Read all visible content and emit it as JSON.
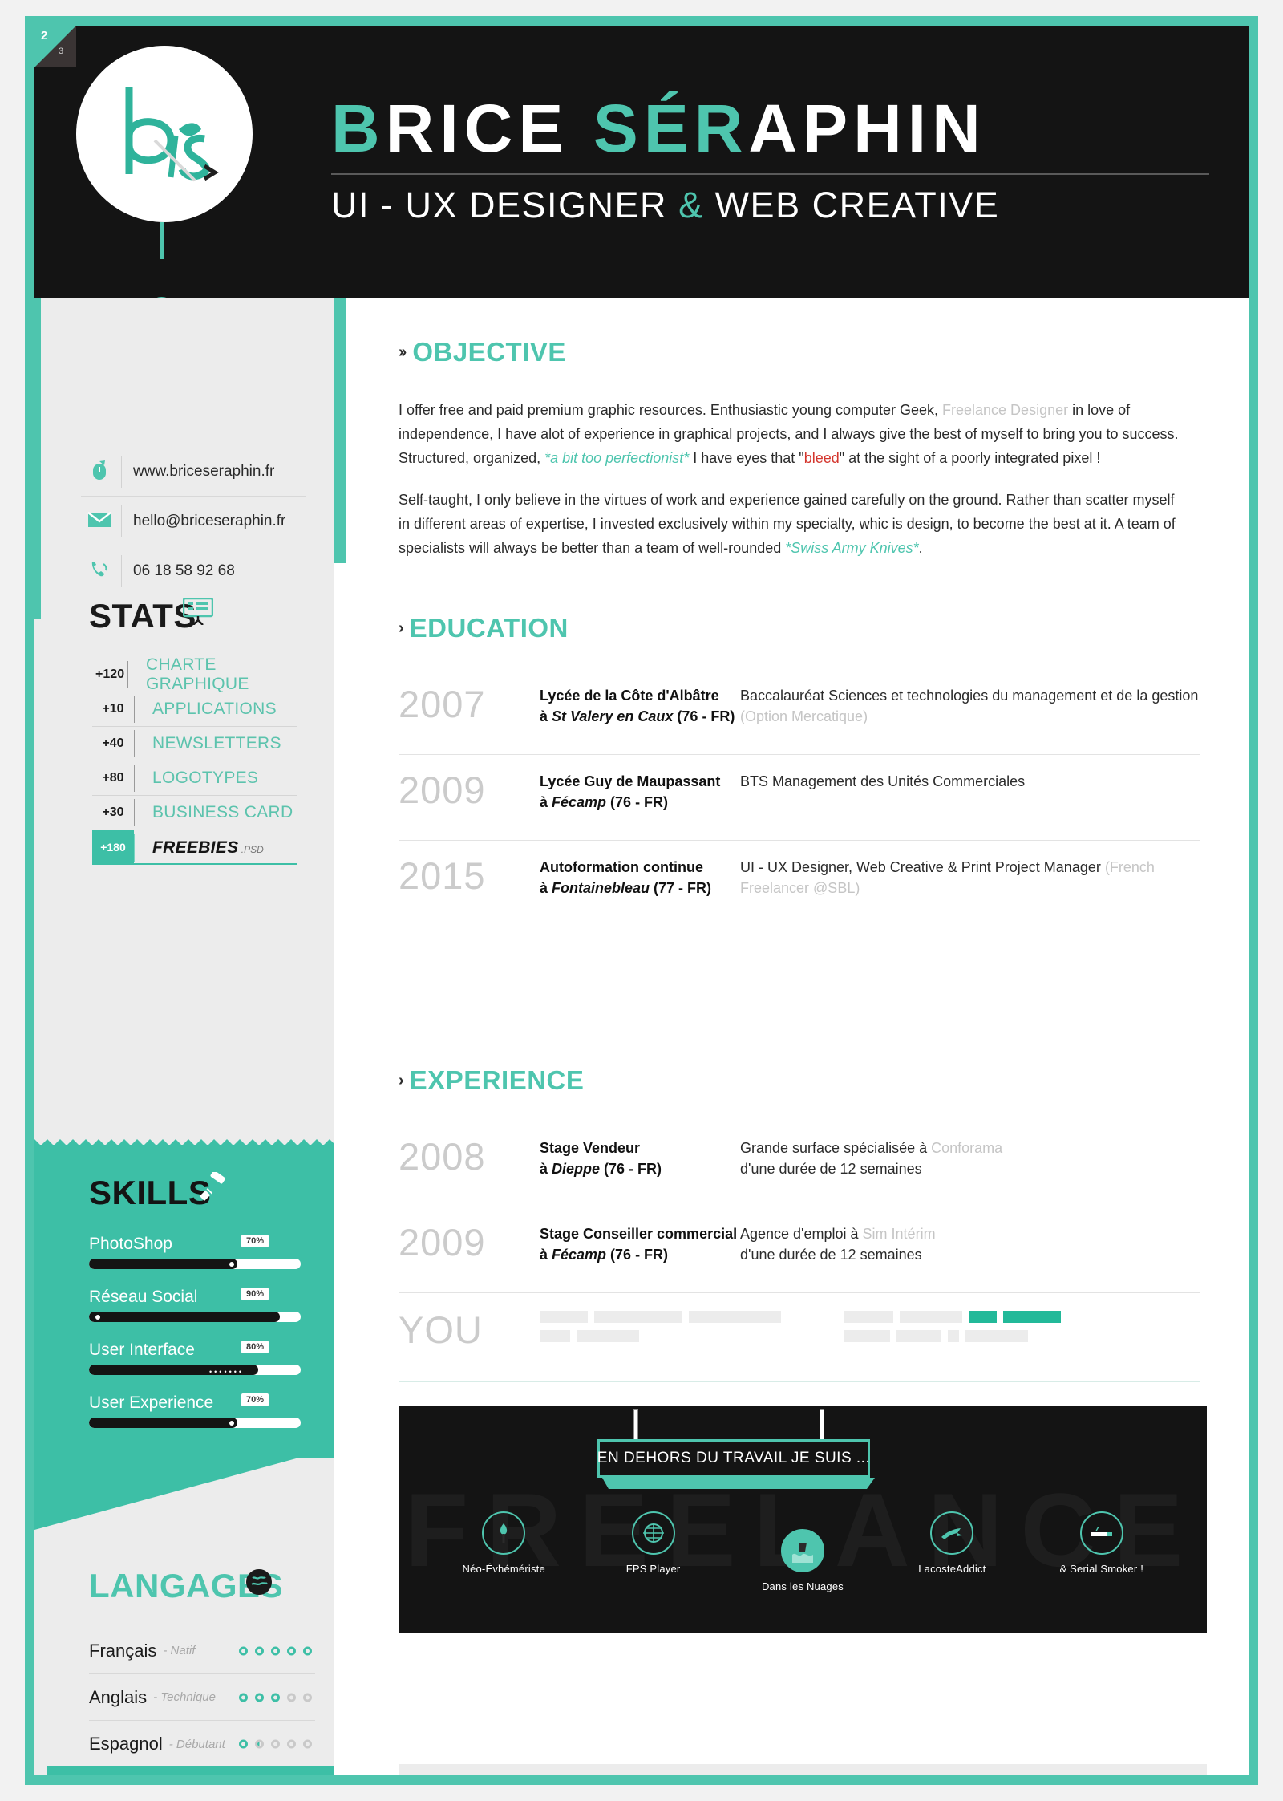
{
  "page_badge": {
    "current": "2",
    "total": "3"
  },
  "header": {
    "name_parts": [
      {
        "text": "B",
        "color": "teal"
      },
      {
        "text": "RICE ",
        "color": "white"
      },
      {
        "text": "SÉR",
        "color": "teal"
      },
      {
        "text": "APHIN",
        "color": "white"
      }
    ],
    "subtitle_before": "UI - UX DESIGNER ",
    "subtitle_amp": "&",
    "subtitle_after": " WEB CREATIVE",
    "logo_initials": "b s"
  },
  "contacts": [
    {
      "icon": "mouse-icon",
      "glyph": "❧",
      "text": "www.briceseraphin.fr"
    },
    {
      "icon": "envelope-icon",
      "glyph": "✉",
      "text": "hello@briceseraphin.fr"
    },
    {
      "icon": "phone-icon",
      "glyph": "☎",
      "text": "06 18 58 92 68"
    }
  ],
  "stats": {
    "title": "STATS",
    "icon": "presentation-chart-icon",
    "rows": [
      {
        "count": "+120",
        "label": "CHARTE GRAPHIQUE",
        "highlight": false,
        "suffix": ""
      },
      {
        "count": "+10",
        "label": "APPLICATIONS",
        "highlight": false,
        "suffix": ""
      },
      {
        "count": "+40",
        "label": "NEWSLETTERS",
        "highlight": false,
        "suffix": ""
      },
      {
        "count": "+80",
        "label": "LOGOTYPES",
        "highlight": false,
        "suffix": ""
      },
      {
        "count": "+30",
        "label": "BUSINESS CARD",
        "highlight": false,
        "suffix": ""
      },
      {
        "count": "+180",
        "label": "FREEBIES",
        "highlight": true,
        "suffix": ".PSD"
      }
    ]
  },
  "skills": {
    "title": "SKILLS",
    "icon": "paintbrush-icon",
    "items": [
      {
        "name": "PhotoShop",
        "percent": "70%",
        "value": 70,
        "style": "knob"
      },
      {
        "name": "Réseau Social",
        "percent": "90%",
        "value": 90,
        "style": "knob-left"
      },
      {
        "name": "User Interface",
        "percent": "80%",
        "value": 80,
        "style": "dots"
      },
      {
        "name": "User Experience",
        "percent": "70%",
        "value": 70,
        "style": "knob"
      }
    ]
  },
  "languages": {
    "title": "LANGAGES",
    "icon": "globe-icon",
    "items": [
      {
        "name": "Français",
        "level": "- Natif",
        "filled": 5,
        "half": 0,
        "total": 5
      },
      {
        "name": "Anglais",
        "level": "- Technique",
        "filled": 3,
        "half": 0,
        "total": 5
      },
      {
        "name": "Espagnol",
        "level": "- Débutant",
        "filled": 1,
        "half": 1,
        "total": 5
      }
    ]
  },
  "objective": {
    "chevron": "››",
    "title": "OBJECTIVE",
    "p1_a": "I offer free and paid premium graphic resources. Enthusiastic young computer Geek, ",
    "p1_grey": "Freelance Designer",
    "p1_b": " in love of independence, I have alot of experience in graphical projects, and I always give the best of myself to bring you to success. Structured, organized, ",
    "p1_teal": "*a bit too perfectionist*",
    "p1_c": " I have eyes that \"",
    "p1_red": "bleed",
    "p1_d": "\" at the sight of a poorly integrated pixel !",
    "p2_a": "Self-taught, I only believe in the virtues of work and experience gained carefully on the ground. Rather than scatter myself in different areas of expertise, I invested exclusively within my specialty, whic is design, to become the best at it. A team of specialists will always be better than a team of well-rounded ",
    "p2_teal": "*Swiss Army Knives*",
    "p2_b": "."
  },
  "education": {
    "chevron": "›",
    "title": "EDUCATION",
    "entries": [
      {
        "year": "2007",
        "school": "Lycée de la Côte d'Albâtre",
        "place_prefix": "à ",
        "place": "St Valery en Caux",
        "place_suffix": " (76 - FR)",
        "desc": "Baccalauréat Sciences et technologies du management et de la gestion ",
        "desc_grey": "(Option Mercatique)"
      },
      {
        "year": "2009",
        "school": "Lycée Guy de Maupassant",
        "place_prefix": "à ",
        "place": "Fécamp",
        "place_suffix": " (76 - FR)",
        "desc": "BTS Management des Unités Commerciales",
        "desc_grey": ""
      },
      {
        "year": "2015",
        "school": "Autoformation continue",
        "place_prefix": "à ",
        "place": "Fontainebleau",
        "place_suffix": " (77 - FR)",
        "desc": "UI - UX Designer, Web Creative & Print Project Manager ",
        "desc_grey": "(French Freelancer @SBL)"
      }
    ]
  },
  "experience": {
    "chevron": "›",
    "title": "EXPERIENCE",
    "entries": [
      {
        "year": "2008",
        "role": "Stage Vendeur",
        "place_prefix": "à ",
        "place": "Dieppe",
        "place_suffix": " (76 - FR)",
        "desc": "Grande surface spécialisée à ",
        "desc_grey": "Conforama",
        "desc2": "d'une durée de 12 semaines"
      },
      {
        "year": "2009",
        "role": "Stage Conseiller commercial",
        "place_prefix": "à ",
        "place": "Fécamp",
        "place_suffix": " (76 - FR)",
        "desc": "Agence d'emploi à ",
        "desc_grey": "Sim Intérim",
        "desc2": "d'une durée de 12 semaines"
      }
    ],
    "you_label": "YOU",
    "placeholders": {
      "group1_line1": [
        60,
        110,
        115
      ],
      "group1_line2": [
        38,
        78
      ],
      "group2_line1": [
        62,
        78,
        35,
        72
      ],
      "group2_line2": [
        58,
        56,
        14,
        78
      ],
      "teal_indices_line1": [
        2,
        3
      ]
    }
  },
  "banner": {
    "watermark": "FREELANCE",
    "sign_text": "EN DEHORS DU TRAVAIL JE SUIS ...",
    "hobbies": [
      {
        "label": "Néo-Évhémériste",
        "icon": "tree-icon",
        "filled": false,
        "glyph": "♠"
      },
      {
        "label": "FPS Player",
        "icon": "crosshair-icon",
        "filled": false,
        "glyph": "⊕"
      },
      {
        "label": "Dans les Nuages",
        "icon": "cloud-wave-icon",
        "filled": true,
        "glyph": "☁"
      },
      {
        "label": "LacosteAddict",
        "icon": "crocodile-icon",
        "filled": false,
        "glyph": "➤"
      },
      {
        "label": "& Serial Smoker !",
        "icon": "cigarette-icon",
        "filled": false,
        "glyph": "━"
      }
    ]
  },
  "colors": {
    "teal": "#4ec5ae",
    "teal_dark": "#3dbfa6",
    "dark": "#141414",
    "grey_bg": "#ececec",
    "red": "#d4362e"
  }
}
